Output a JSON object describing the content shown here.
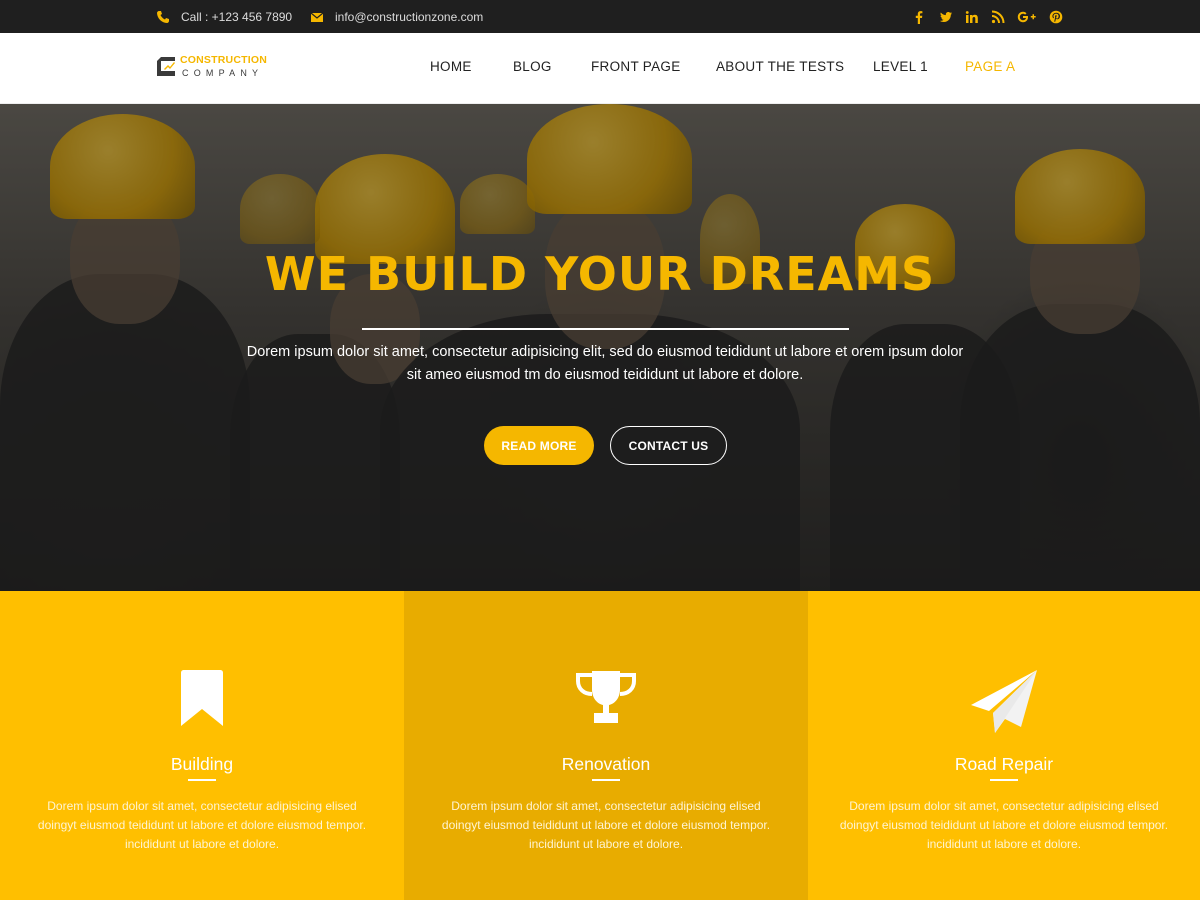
{
  "topbar": {
    "phone": "Call : +123 456 7890",
    "email": "info@constructionzone.com",
    "social_icons": [
      "facebook-icon",
      "twitter-icon",
      "linkedin-icon",
      "rss-icon",
      "google-plus-icon",
      "pinterest-icon"
    ]
  },
  "logo": {
    "line1": "CONSTRUCTION",
    "line2": "COMPANY"
  },
  "nav": {
    "items": [
      {
        "label": "HOME"
      },
      {
        "label": "BLOG"
      },
      {
        "label": "FRONT PAGE"
      },
      {
        "label": "ABOUT THE TESTS"
      },
      {
        "label": "LEVEL 1"
      },
      {
        "label": "PAGE A"
      }
    ],
    "active": "PAGE A"
  },
  "hero": {
    "title": "WE BUILD YOUR DREAMS",
    "lead": "Dorem ipsum dolor sit amet, consectetur adipisicing elit, sed do eiusmod teididunt ut labore et orem ipsum dolor sit ameo eiusmod tm do eiusmod teididunt ut labore et dolore.",
    "read_more": "READ MORE",
    "contact_us": "CONTACT US"
  },
  "services": [
    {
      "icon": "bookmark-icon",
      "title": "Building",
      "text": "Dorem ipsum dolor sit amet, consectetur adipisicing elised doingyt eiusmod teididunt ut labore et dolore eiusmod tempor. incididunt ut labore et dolore."
    },
    {
      "icon": "trophy-icon",
      "title": "Renovation",
      "text": "Dorem ipsum dolor sit amet, consectetur adipisicing elised doingyt eiusmod teididunt ut labore et dolore eiusmod tempor. incididunt ut labore et dolore."
    },
    {
      "icon": "paper-plane-icon",
      "title": "Road Repair",
      "text": "Dorem ipsum dolor sit amet, consectetur adipisicing elised doingyt eiusmod teididunt ut labore et dolore eiusmod tempor. incididunt ut labore et dolore."
    }
  ],
  "colors": {
    "accent": "#f5b700",
    "topbar_bg": "#1f1f1f",
    "service_bg": "#ffbf00",
    "service_bg_alt": "#e8ac00"
  }
}
